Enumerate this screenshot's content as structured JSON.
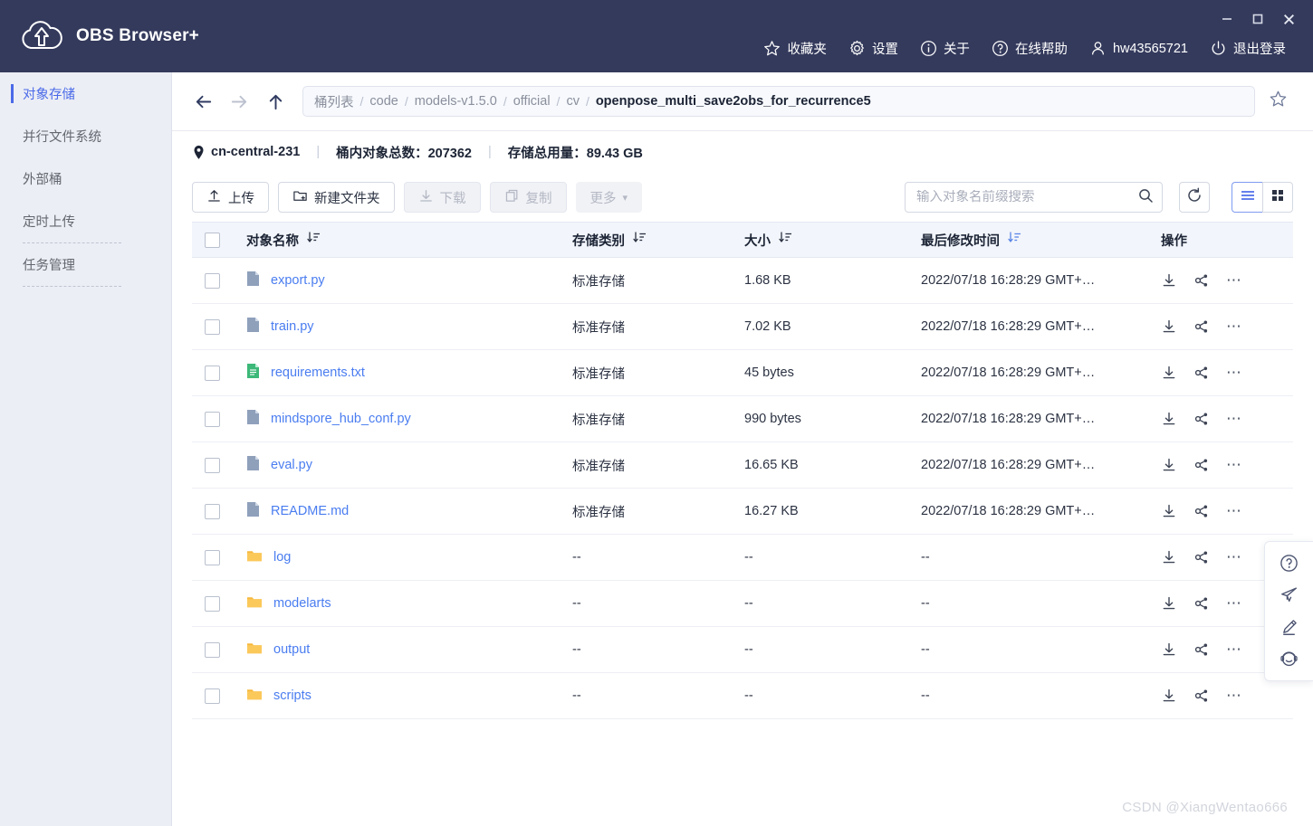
{
  "app": {
    "title": "OBS Browser+",
    "logo_icon": "cloud-upload-icon"
  },
  "window_controls": {
    "minimize": "−",
    "maximize": "□",
    "close": "✕"
  },
  "top_menu": [
    {
      "label": "收藏夹",
      "icon": "star-icon"
    },
    {
      "label": "设置",
      "icon": "gear-icon"
    },
    {
      "label": "关于",
      "icon": "info-icon"
    },
    {
      "label": "在线帮助",
      "icon": "question-circle-icon"
    },
    {
      "label": "hw43565721",
      "icon": "user-icon"
    },
    {
      "label": "退出登录",
      "icon": "power-icon"
    }
  ],
  "sidebar": {
    "items": [
      {
        "label": "对象存储",
        "active": true
      },
      {
        "label": "并行文件系统",
        "active": false
      },
      {
        "label": "外部桶",
        "active": false
      },
      {
        "label": "定时上传",
        "active": false
      },
      {
        "label": "任务管理",
        "active": false
      }
    ]
  },
  "nav": {
    "back_icon": "arrow-left-icon",
    "forward_icon": "arrow-right-icon",
    "up_icon": "arrow-up-icon",
    "bookmark_icon": "star-outline-icon",
    "breadcrumb": [
      "桶列表",
      "code",
      "models-v1.5.0",
      "official",
      "cv",
      "openpose_multi_save2obs_for_recurrence5"
    ],
    "separator": "/"
  },
  "info": {
    "region": "cn-central-231",
    "object_count_label": "桶内对象总数：207362",
    "storage_used_label": "存储总用量：89.43 GB",
    "divider": "|"
  },
  "toolbar": {
    "upload": "上传",
    "new_folder": "新建文件夹",
    "download": "下载",
    "copy": "复制",
    "more": "更多",
    "more_caret": "▾",
    "search_placeholder": "输入对象名前缀搜索",
    "search_value": ""
  },
  "table": {
    "columns": [
      "对象名称",
      "存储类别",
      "大小",
      "最后修改时间",
      "操作"
    ],
    "rows": [
      {
        "name": "export.py",
        "icon": "file-icon",
        "storage_class": "标准存储",
        "size": "1.68 KB",
        "modified": "2022/07/18 16:28:29 GMT+…"
      },
      {
        "name": "train.py",
        "icon": "file-icon",
        "storage_class": "标准存储",
        "size": "7.02 KB",
        "modified": "2022/07/18 16:28:29 GMT+…"
      },
      {
        "name": "requirements.txt",
        "icon": "text-file-icon",
        "storage_class": "标准存储",
        "size": "45 bytes",
        "modified": "2022/07/18 16:28:29 GMT+…"
      },
      {
        "name": "mindspore_hub_conf.py",
        "icon": "file-icon",
        "storage_class": "标准存储",
        "size": "990 bytes",
        "modified": "2022/07/18 16:28:29 GMT+…"
      },
      {
        "name": "eval.py",
        "icon": "file-icon",
        "storage_class": "标准存储",
        "size": "16.65 KB",
        "modified": "2022/07/18 16:28:29 GMT+…"
      },
      {
        "name": "README.md",
        "icon": "file-icon",
        "storage_class": "标准存储",
        "size": "16.27 KB",
        "modified": "2022/07/18 16:28:29 GMT+…"
      },
      {
        "name": "log",
        "icon": "folder-icon",
        "storage_class": "--",
        "size": "--",
        "modified": "--"
      },
      {
        "name": "modelarts",
        "icon": "folder-icon",
        "storage_class": "--",
        "size": "--",
        "modified": "--"
      },
      {
        "name": "output",
        "icon": "folder-icon",
        "storage_class": "--",
        "size": "--",
        "modified": "--"
      },
      {
        "name": "scripts",
        "icon": "folder-icon",
        "storage_class": "--",
        "size": "--",
        "modified": "--"
      }
    ],
    "row_actions": {
      "download": "download-icon",
      "share": "share-icon",
      "more": "⋯"
    }
  },
  "float_panel": [
    {
      "icon": "help-circle-icon"
    },
    {
      "icon": "paper-plane-icon"
    },
    {
      "icon": "pencil-icon"
    },
    {
      "icon": "headset-icon"
    }
  ],
  "watermark": "CSDN @XiangWentao666",
  "colors": {
    "titlebar": "#343a5c",
    "accent": "#4a6ae8",
    "link": "#4a7df0",
    "folder": "#f6b83d",
    "sidebar_bg": "#eceef5"
  }
}
